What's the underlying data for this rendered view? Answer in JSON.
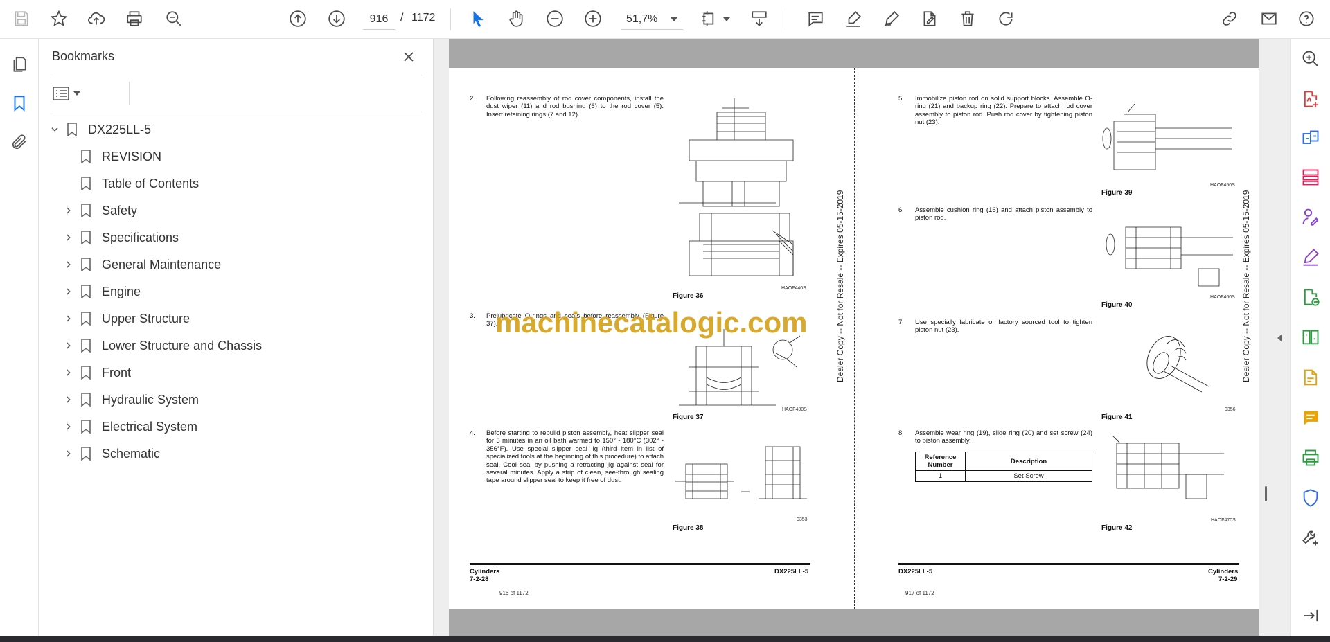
{
  "toolbar": {
    "page_current": "916",
    "page_separator": "/",
    "page_total": "1172",
    "zoom": "51,7%"
  },
  "bookmarks": {
    "title": "Bookmarks",
    "root": "DX225LL-5",
    "items": [
      {
        "label": "REVISION",
        "expandable": false
      },
      {
        "label": "Table of Contents",
        "expandable": false
      },
      {
        "label": "Safety",
        "expandable": true
      },
      {
        "label": "Specifications",
        "expandable": true
      },
      {
        "label": "General Maintenance",
        "expandable": true
      },
      {
        "label": "Engine",
        "expandable": true
      },
      {
        "label": "Upper Structure",
        "expandable": true
      },
      {
        "label": "Lower Structure and Chassis",
        "expandable": true
      },
      {
        "label": "Front",
        "expandable": true
      },
      {
        "label": "Hydraulic System",
        "expandable": true
      },
      {
        "label": "Electrical System",
        "expandable": true
      },
      {
        "label": "Schematic",
        "expandable": true
      }
    ]
  },
  "document": {
    "watermark": "machinecatalogic.com",
    "side_stamp": "Dealer Copy -- Not for Resale -- Expires 05-15-2019",
    "left_page": {
      "steps": [
        {
          "num": "2.",
          "text": "Following reassembly of rod cover components, install the dust wiper (11) and rod bushing (6) to the rod cover (5). Insert retaining rings (7 and 12)."
        },
        {
          "num": "3.",
          "text": "Prelubricate O-rings and seals before reassembly (Figure 37)."
        },
        {
          "num": "4.",
          "text": "Before starting to rebuild piston assembly, heat slipper seal for 5 minutes in an oil bath warmed to 150° - 180°C (302° - 356°F). Use special slipper seal jig (third item in list of specialized tools at the beginning of this procedure) to attach seal. Cool seal by pushing a retracting jig against seal for several minutes. Apply a strip of clean, see-through sealing tape around slipper seal to keep it free of dust."
        }
      ],
      "figures": [
        {
          "caption": "Figure 36",
          "code": "HAOF440S"
        },
        {
          "caption": "Figure 37",
          "code": "HAOF430S"
        },
        {
          "caption": "Figure 38",
          "code": "0353"
        }
      ],
      "footer_left_title": "Cylinders",
      "footer_left_num": "7-2-28",
      "footer_right": "DX225LL-5",
      "page_of": "916 of 1172"
    },
    "right_page": {
      "steps": [
        {
          "num": "5.",
          "text": "Immobilize piston rod on solid support blocks. Assemble O-ring (21) and backup ring (22). Prepare to attach rod cover assembly to piston rod. Push rod cover by tightening piston nut (23)."
        },
        {
          "num": "6.",
          "text": "Assemble cushion ring (16) and attach piston assembly to piston rod."
        },
        {
          "num": "7.",
          "text": "Use specially fabricate or factory sourced tool to tighten piston nut (23)."
        },
        {
          "num": "8.",
          "text": "Assemble wear ring (19), slide ring (20) and set screw (24) to piston assembly."
        }
      ],
      "figures": [
        {
          "caption": "Figure 39",
          "code": "HAOF450S"
        },
        {
          "caption": "Figure 40",
          "code": "HAOF460S"
        },
        {
          "caption": "Figure 41",
          "code": "0356"
        },
        {
          "caption": "Figure 42",
          "code": "HAOF470S"
        }
      ],
      "table": {
        "headers": [
          "Reference Number",
          "Description"
        ],
        "rows": [
          [
            "1",
            "Set Screw"
          ]
        ]
      },
      "footer_left": "DX225LL-5",
      "footer_right_title": "Cylinders",
      "footer_right_num": "7-2-29",
      "page_of": "917 of 1172"
    }
  },
  "colors": {
    "accent": "#1473e6",
    "watermark": "#d6a21a",
    "rail_pink": "#d6245b",
    "rail_blue": "#2d6be0",
    "rail_purple": "#8b3fd1",
    "rail_green": "#2a9d3f",
    "rail_yellow": "#e8a400",
    "rail_red": "#e23b3b"
  }
}
